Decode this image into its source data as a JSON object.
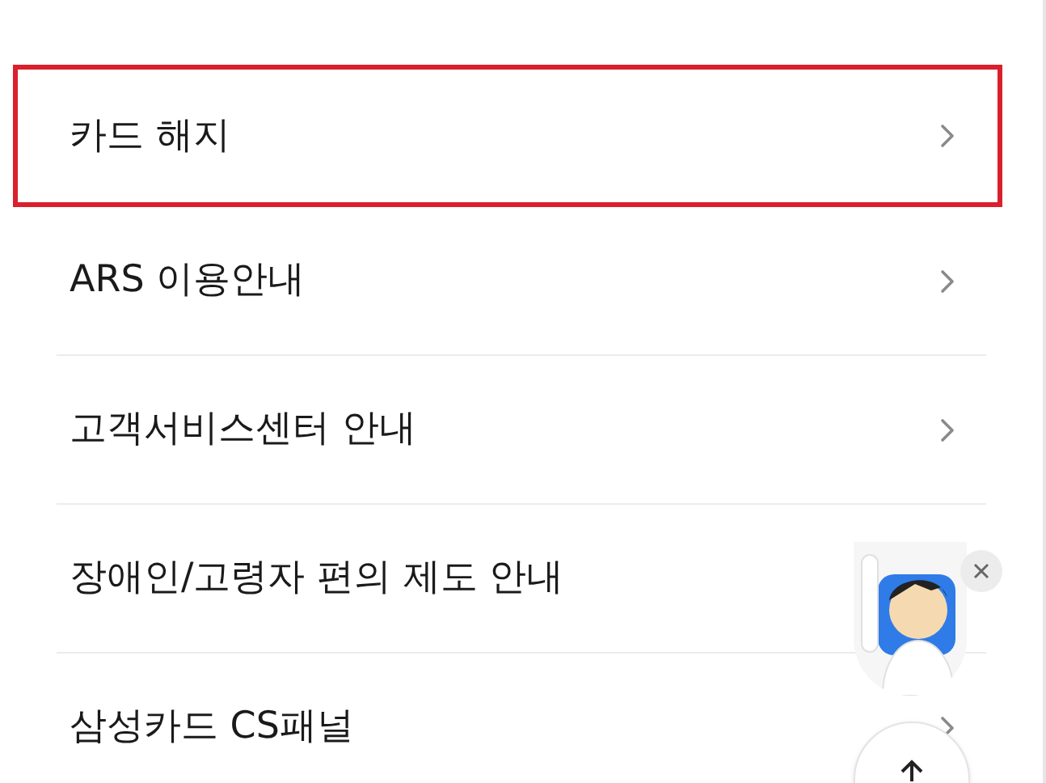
{
  "menu_items": [
    {
      "label": "카드 해지",
      "highlighted": true
    },
    {
      "label": "ARS 이용안내",
      "highlighted": false
    },
    {
      "label": "고객서비스센터 안내",
      "highlighted": false
    },
    {
      "label": "장애인/고령자 편의 제도 안내",
      "highlighted": false
    },
    {
      "label": "삼성카드 CS패널",
      "highlighted": false
    }
  ]
}
